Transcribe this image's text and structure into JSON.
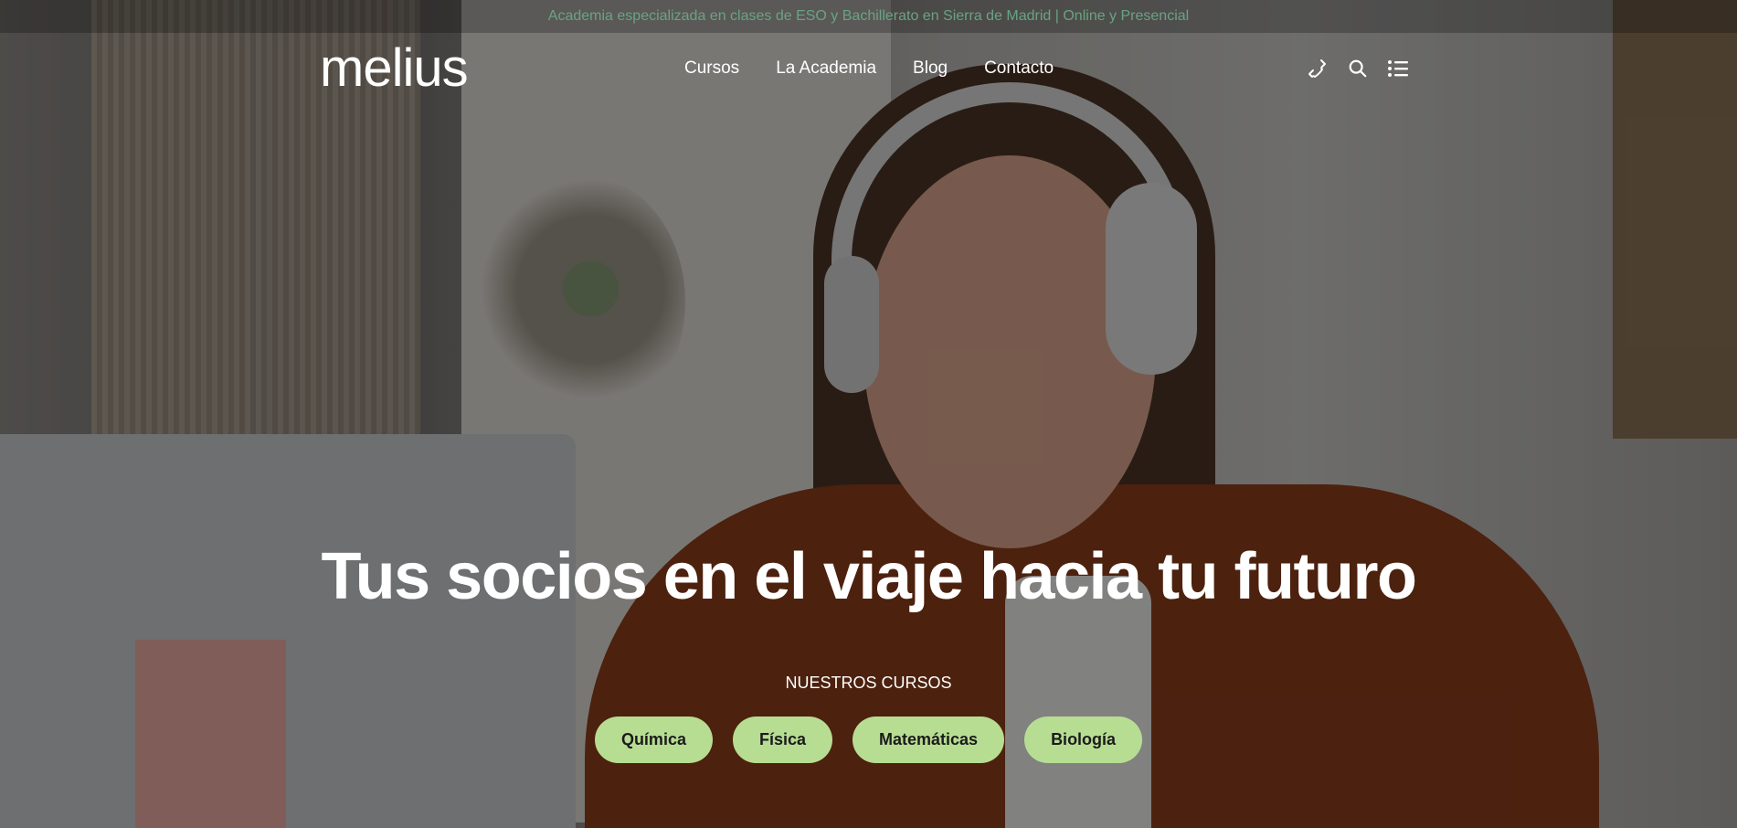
{
  "topbar": {
    "text": "Academia especializada en clases de ESO y Bachillerato en Sierra de Madrid | Online y Presencial"
  },
  "header": {
    "logo": "melius",
    "nav": [
      "Cursos",
      "La Academia",
      "Blog",
      "Contacto"
    ],
    "icons": [
      "phone-icon",
      "search-icon",
      "menu-list-icon"
    ]
  },
  "hero": {
    "headline": "Tus socios en el viaje hacia tu futuro",
    "subhead": "NUESTROS CURSOS",
    "courses": [
      "Química",
      "Física",
      "Matemáticas",
      "Biología"
    ]
  },
  "colors": {
    "accent_green": "#b7dd93",
    "topbar_text": "#6aa382"
  }
}
